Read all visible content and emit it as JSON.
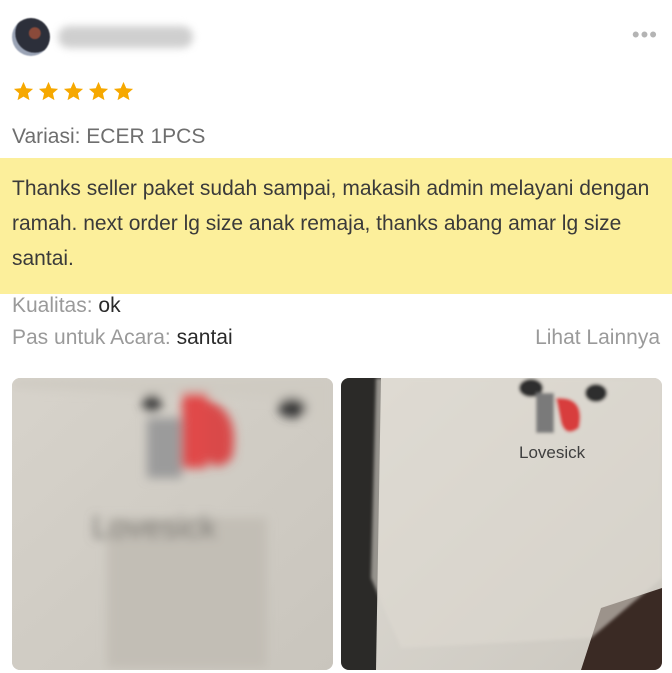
{
  "review": {
    "username": "user",
    "more_icon": "more-horizontal-icon",
    "rating": 5,
    "max_rating": 5,
    "variation": "Variasi: ECER 1PCS",
    "text": "Thanks seller paket sudah sampai, makasih admin melayani dengan ramah. next order lg size anak remaja, thanks abang amar lg size santai.",
    "quality_label": "Kualitas:",
    "quality_value": "ok",
    "occasion_label": "Pas untuk Acara:",
    "occasion_value": "santai",
    "see_more": "Lihat Lainnya",
    "photos": [
      {
        "alt": "Photo of white t-shirt with red graphic"
      },
      {
        "alt": "Photo of white t-shirt with Lovesick print",
        "print": "Lovesick"
      }
    ]
  },
  "colors": {
    "star": "#f6a800",
    "highlight": "#fcef9b",
    "label_gray": "#9a9a9a"
  }
}
